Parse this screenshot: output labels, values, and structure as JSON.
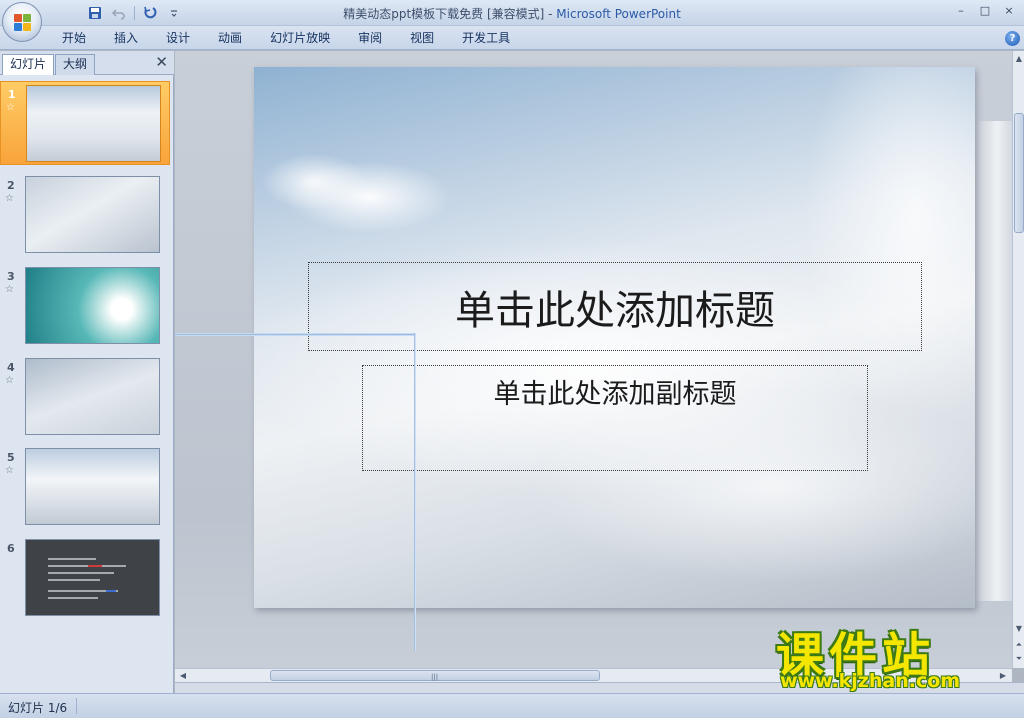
{
  "window": {
    "title_doc": "精美动态ppt模板下载免费 [兼容模式]",
    "title_sep": " - ",
    "title_app": "Microsoft PowerPoint",
    "controls": [
      "–",
      "□",
      "×"
    ]
  },
  "quick_access": {
    "save_icon": "save-icon",
    "undo_icon": "undo-icon",
    "redo_icon": "redo-icon",
    "customize_icon": "customize-icon"
  },
  "ribbon": {
    "tabs": [
      "开始",
      "插入",
      "设计",
      "动画",
      "幻灯片放映",
      "审阅",
      "视图",
      "开发工具"
    ],
    "help": "?"
  },
  "pane": {
    "tab_slides": "幻灯片",
    "tab_outline": "大纲",
    "close": "✕",
    "selected_index": 0,
    "slides": [
      {
        "number": "1",
        "anim": "☆"
      },
      {
        "number": "2",
        "anim": "☆"
      },
      {
        "number": "3",
        "anim": "☆"
      },
      {
        "number": "4",
        "anim": "☆"
      },
      {
        "number": "5",
        "anim": "☆"
      },
      {
        "number": "6",
        "anim": ""
      }
    ]
  },
  "slide": {
    "title_placeholder": "单击此处添加标题",
    "subtitle_placeholder": "单击此处添加副标题"
  },
  "statusbar": {
    "slide_count": "幻灯片 1/6"
  },
  "watermark": {
    "main": "课件站",
    "url": "www.kjzhan.com"
  },
  "colors": {
    "accent": "#2b5aa8",
    "selection": "#f8a43a",
    "watermark_fill": "#f4e600",
    "watermark_stroke": "#3d7a16"
  }
}
